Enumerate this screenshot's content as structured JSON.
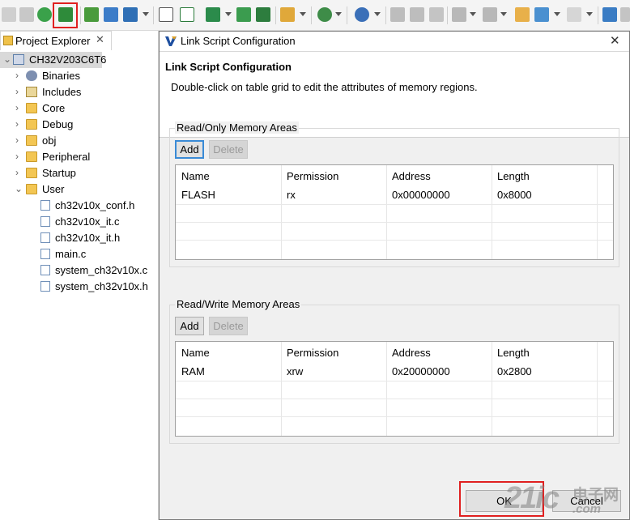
{
  "explorer": {
    "title": "Project Explorer",
    "close_glyph": "✕",
    "project": "CH32V203C6T6",
    "items": [
      {
        "label": "Binaries",
        "icon": "binaries-icon"
      },
      {
        "label": "Includes",
        "icon": "includes-icon"
      },
      {
        "label": "Core",
        "icon": "folder-icon"
      },
      {
        "label": "Debug",
        "icon": "folder-icon"
      },
      {
        "label": "obj",
        "icon": "folder-icon"
      },
      {
        "label": "Peripheral",
        "icon": "folder-icon"
      },
      {
        "label": "Startup",
        "icon": "folder-icon"
      },
      {
        "label": "User",
        "icon": "folder-icon"
      }
    ],
    "user_files": [
      {
        "label": "ch32v10x_conf.h",
        "icon": "header-file-icon"
      },
      {
        "label": "ch32v10x_it.c",
        "icon": "c-file-icon"
      },
      {
        "label": "ch32v10x_it.h",
        "icon": "header-file-icon"
      },
      {
        "label": "main.c",
        "icon": "c-file-icon"
      },
      {
        "label": "system_ch32v10x.c",
        "icon": "c-file-icon"
      },
      {
        "label": "system_ch32v10x.h",
        "icon": "header-file-icon"
      }
    ]
  },
  "dialog": {
    "window_title": "Link Script Configuration",
    "heading": "Link Script Configuration",
    "description": "Double-click on table grid to edit the attributes of memory regions.",
    "ro_group": {
      "title": "Read/Only Memory Areas",
      "add_label": "Add",
      "delete_label": "Delete",
      "columns": [
        "Name",
        "Permission",
        "Address",
        "Length"
      ],
      "rows": [
        [
          "FLASH",
          "rx",
          "0x00000000",
          "0x8000"
        ]
      ]
    },
    "rw_group": {
      "title": "Read/Write Memory Areas",
      "add_label": "Add",
      "delete_label": "Delete",
      "columns": [
        "Name",
        "Permission",
        "Address",
        "Length"
      ],
      "rows": [
        [
          "RAM",
          "xrw",
          "0x20000000",
          "0x2800"
        ]
      ]
    },
    "ok_label": "OK",
    "cancel_label": "Cancel"
  },
  "watermark": {
    "number": "21ic",
    "brand": "电子网",
    "domain": ".com"
  },
  "colors": {
    "highlight_red": "#e02020",
    "focus_blue": "#3a8bd6",
    "folder_yellow": "#f3c653"
  }
}
